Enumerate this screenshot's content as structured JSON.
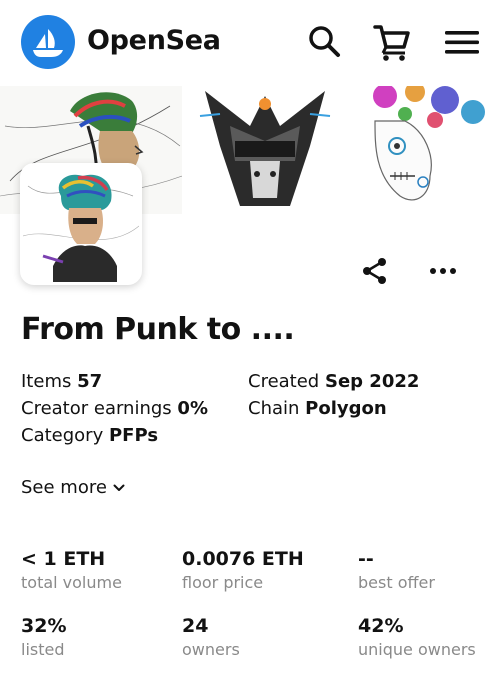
{
  "header": {
    "brand": "OpenSea",
    "icons": [
      "search-icon",
      "cart-icon",
      "menu-icon"
    ],
    "brand_color": "#2081e2"
  },
  "collection": {
    "name": "From Punk to ....",
    "details": {
      "items_label": "Items",
      "items_value": "57",
      "created_label": "Created",
      "created_value": "Sep 2022",
      "earnings_label": "Creator earnings",
      "earnings_value": "0%",
      "chain_label": "Chain",
      "chain_value": "Polygon",
      "category_label": "Category",
      "category_value": "PFPs"
    },
    "see_more": "See more"
  },
  "stats": [
    {
      "value": "< 1 ETH",
      "label": "total volume"
    },
    {
      "value": "0.0076 ETH",
      "label": "floor price"
    },
    {
      "value": "--",
      "label": "best offer"
    },
    {
      "value": "32%",
      "label": "listed"
    },
    {
      "value": "24",
      "label": "owners"
    },
    {
      "value": "42%",
      "label": "unique owners"
    }
  ]
}
